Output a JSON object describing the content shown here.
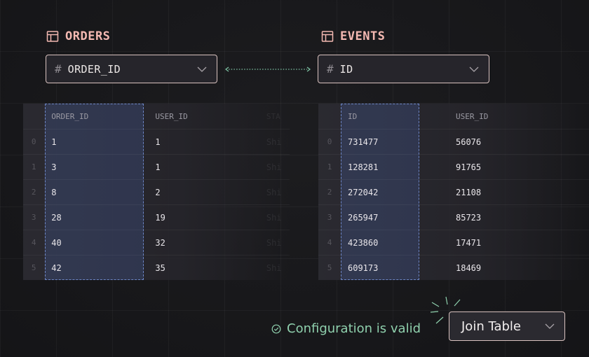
{
  "left": {
    "title": "ORDERS",
    "key": "ORDER_ID",
    "columns": [
      "ORDER_ID",
      "USER_ID",
      "STA"
    ],
    "rows": [
      {
        "idx": "0",
        "c1": "1",
        "c2": "1",
        "c3": "Shi"
      },
      {
        "idx": "1",
        "c1": "3",
        "c2": "1",
        "c3": "Shi"
      },
      {
        "idx": "2",
        "c1": "8",
        "c2": "2",
        "c3": "Shi"
      },
      {
        "idx": "3",
        "c1": "28",
        "c2": "19",
        "c3": "Shi"
      },
      {
        "idx": "4",
        "c1": "40",
        "c2": "32",
        "c3": "Shi"
      },
      {
        "idx": "5",
        "c1": "42",
        "c2": "35",
        "c3": "Shi"
      }
    ]
  },
  "right": {
    "title": "EVENTS",
    "key": "ID",
    "columns": [
      "ID",
      "USER_ID",
      ""
    ],
    "rows": [
      {
        "idx": "0",
        "c1": "731477",
        "c2": "56076",
        "c3": ""
      },
      {
        "idx": "1",
        "c1": "128281",
        "c2": "91765",
        "c3": ""
      },
      {
        "idx": "2",
        "c1": "272042",
        "c2": "21108",
        "c3": ""
      },
      {
        "idx": "3",
        "c1": "265947",
        "c2": "85723",
        "c3": ""
      },
      {
        "idx": "4",
        "c1": "423860",
        "c2": "17471",
        "c3": ""
      },
      {
        "idx": "5",
        "c1": "609173",
        "c2": "18469",
        "c3": ""
      }
    ]
  },
  "status": {
    "text": "Configuration is valid",
    "color": "#8fd0ad"
  },
  "join": {
    "label": "Join Table"
  },
  "colors": {
    "accent": "#f4b9b2",
    "selection": "#6d86c7"
  }
}
